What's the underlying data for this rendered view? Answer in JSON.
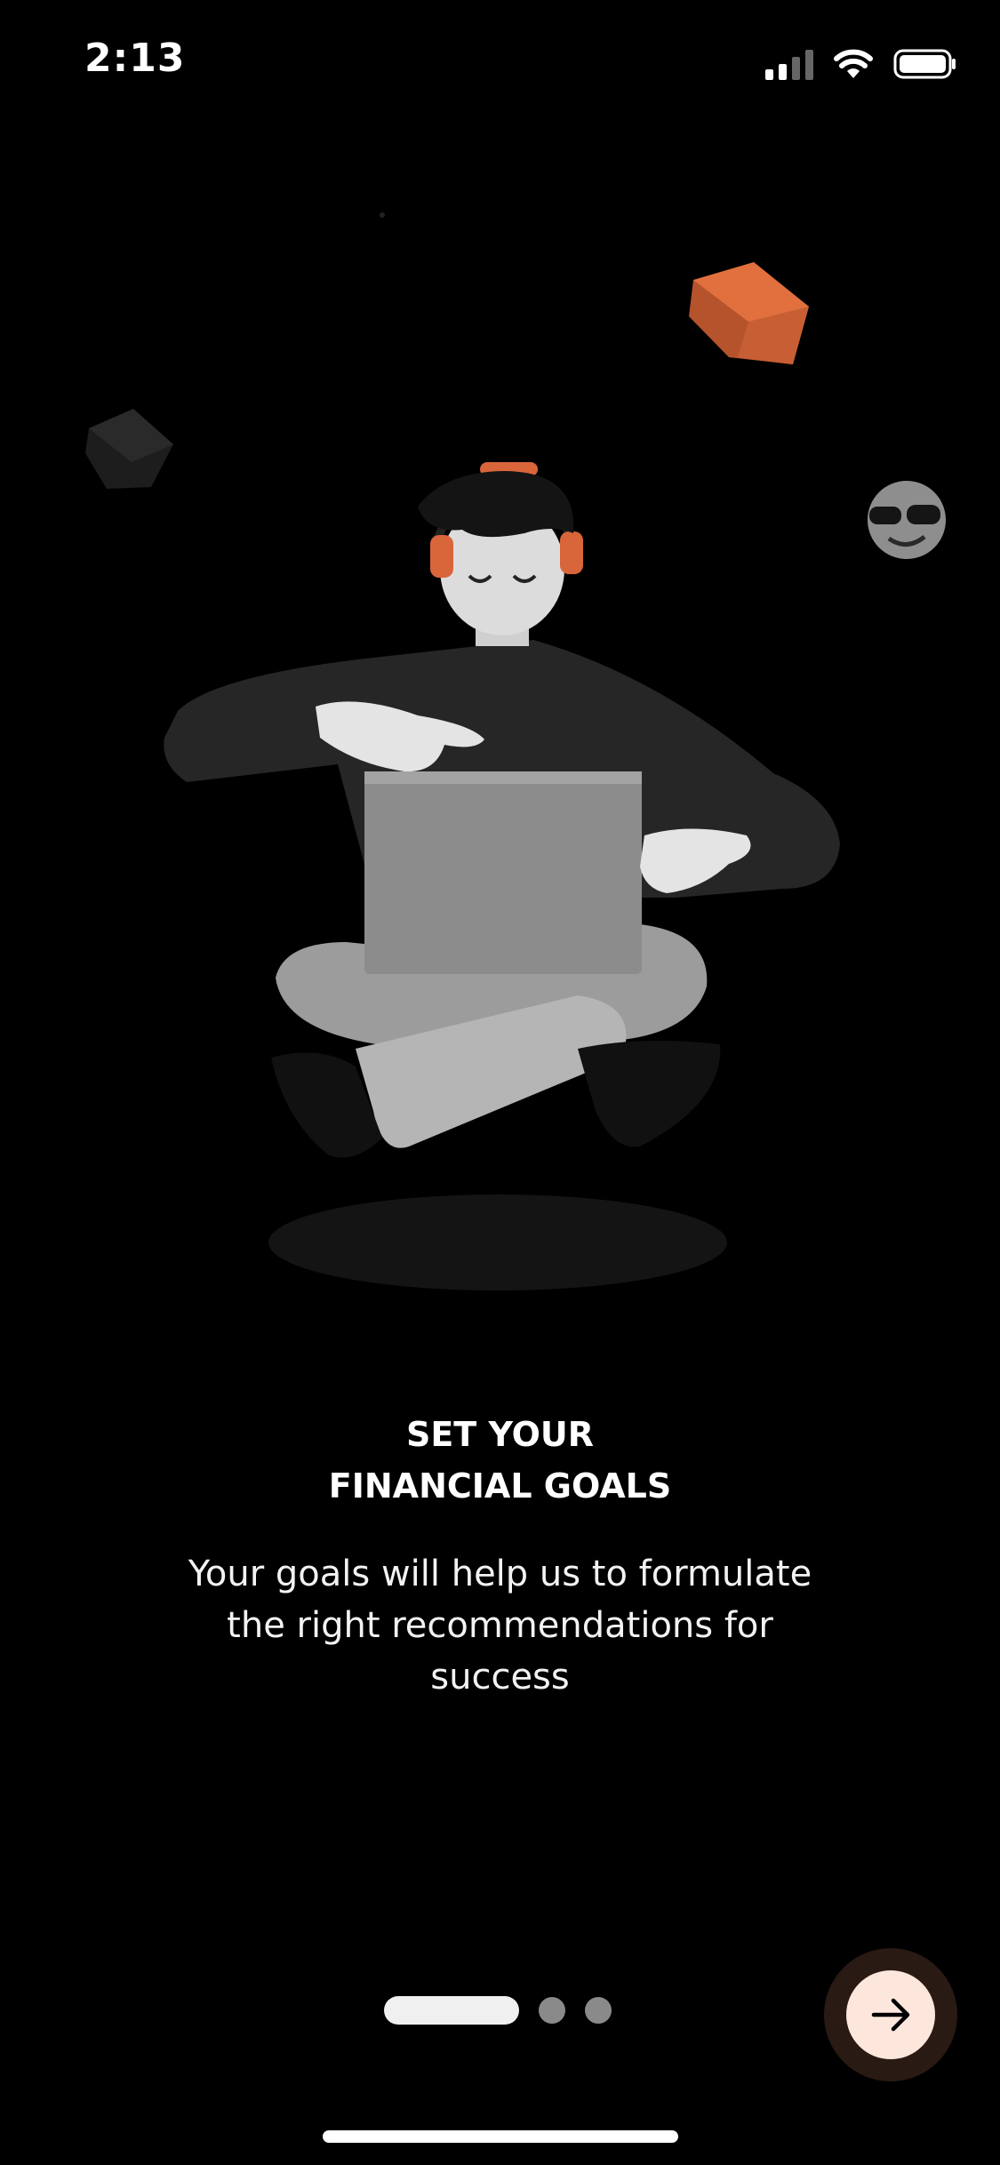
{
  "status_bar": {
    "time": "2:13",
    "icons": [
      "signal-icon",
      "wifi-icon",
      "battery-icon"
    ]
  },
  "onboarding": {
    "title_line1": "SET YOUR",
    "title_line2": "FINANCIAL GOALS",
    "description": "Your goals will help us to formulate the right recommendations for success",
    "illustration": "person-meditating-with-laptop",
    "pager": {
      "total_pages": 3,
      "current_page": 1
    },
    "next_button_icon": "arrow-right-icon"
  },
  "colors": {
    "background": "#000000",
    "accent": "#d9653b",
    "next_button_fill": "#fde7dc",
    "next_button_ring": "#2a1a14",
    "text": "#ffffff"
  }
}
